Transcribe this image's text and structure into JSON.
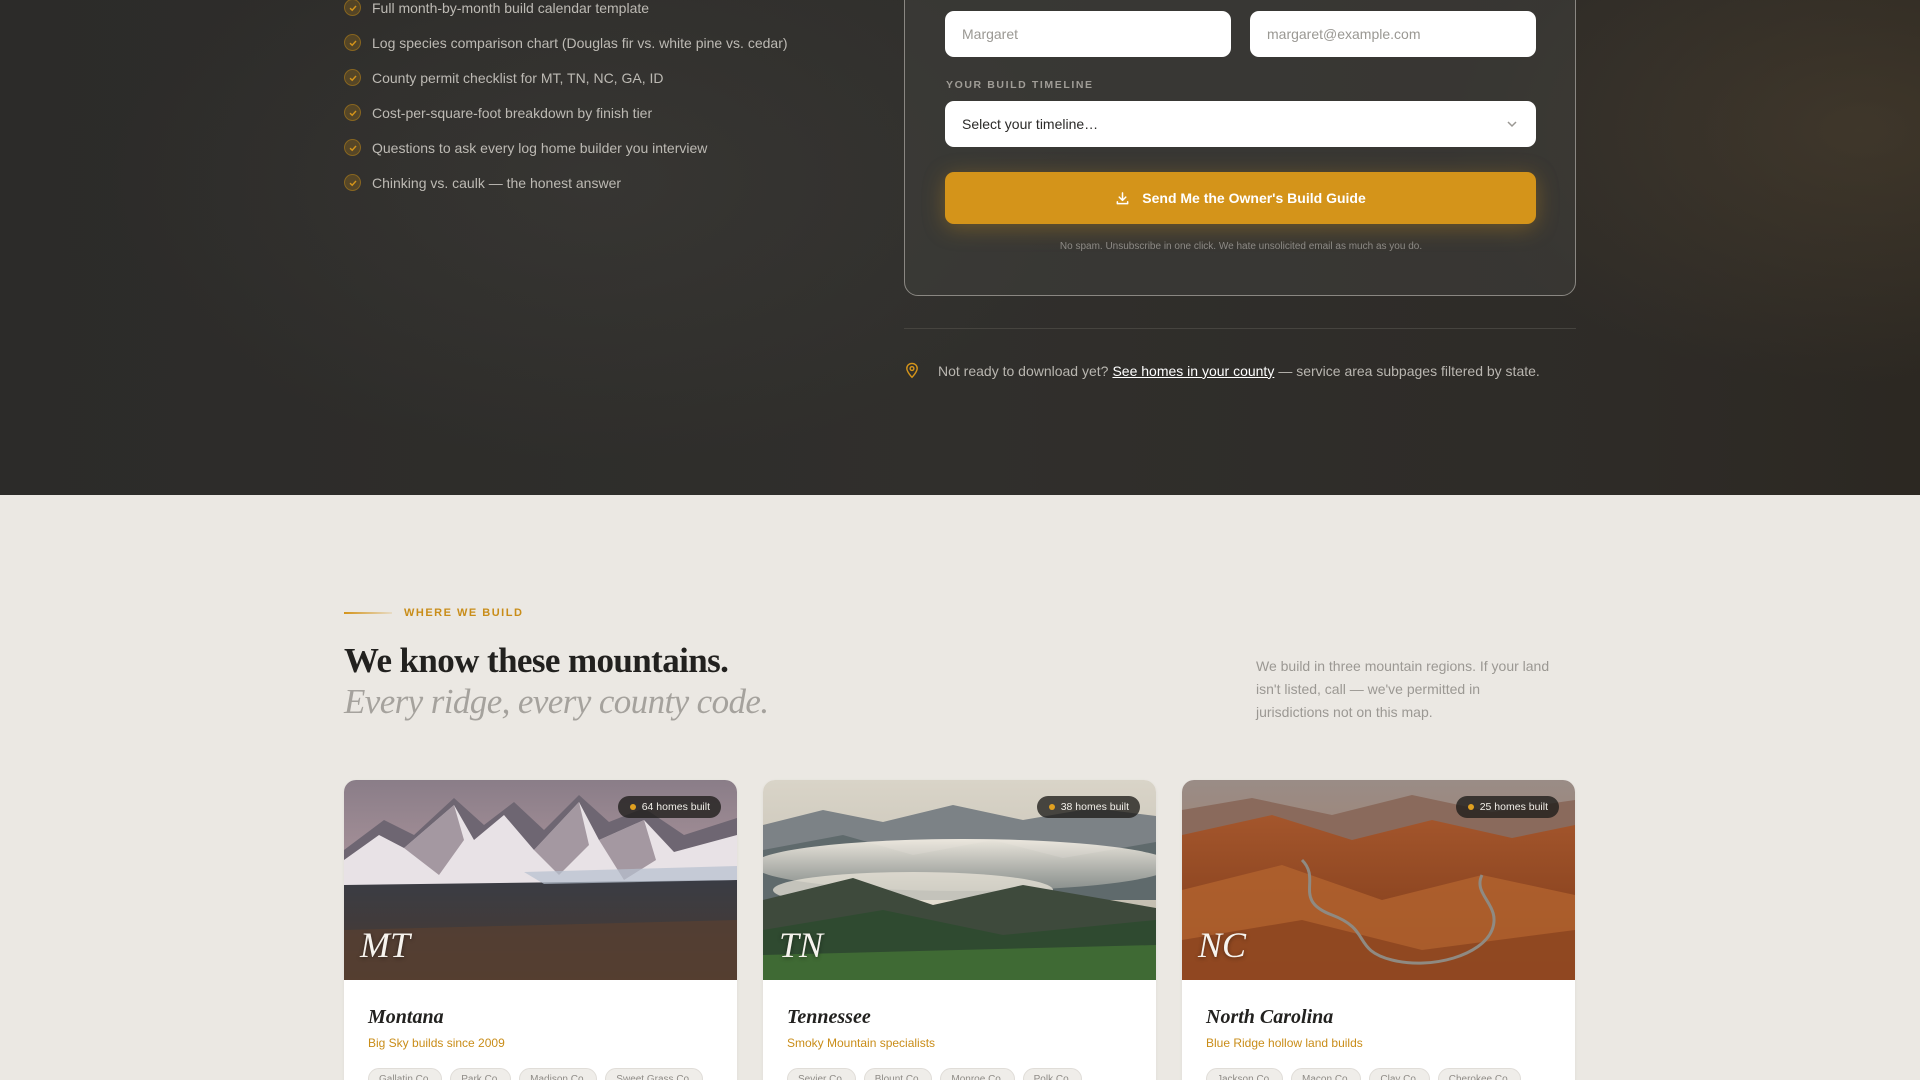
{
  "checklist": {
    "items": [
      "Full month-by-month build calendar template",
      "Log species comparison chart (Douglas fir vs. white pine vs. cedar)",
      "County permit checklist for MT, TN, NC, GA, ID",
      "Cost-per-square-foot breakdown by finish tier",
      "Questions to ask every log home builder you interview",
      "Chinking vs. caulk — the honest answer"
    ]
  },
  "form": {
    "name_placeholder": "Margaret",
    "email_placeholder": "margaret@example.com",
    "timeline_label": "YOUR BUILD TIMELINE",
    "timeline_value": "Select your timeline…",
    "submit_label": "Send Me the Owner's Build Guide",
    "fineprint": "No spam. Unsubscribe in one click. We hate unsolicited email as much as you do."
  },
  "county_note": {
    "before": "Not ready to download yet?",
    "link": "See homes in your county",
    "after": "— service area subpages filtered by state."
  },
  "regions": {
    "eyebrow": "WHERE WE BUILD",
    "headline": "We know these mountains.",
    "subhead": "Every ridge, every county code.",
    "intro": "We build in three mountain regions. If your land isn't listed, call — we've permitted in jurisdictions not on this map.",
    "cards": [
      {
        "abbr": "MT",
        "badge": "64 homes built",
        "title": "Montana",
        "subtitle": "Big Sky builds since 2009",
        "counties": [
          "Gallatin Co.",
          "Park Co.",
          "Madison Co.",
          "Sweet Grass Co."
        ]
      },
      {
        "abbr": "TN",
        "badge": "38 homes built",
        "title": "Tennessee",
        "subtitle": "Smoky Mountain specialists",
        "counties": [
          "Sevier Co.",
          "Blount Co.",
          "Monroe Co.",
          "Polk Co."
        ]
      },
      {
        "abbr": "NC",
        "badge": "25 homes built",
        "title": "North Carolina",
        "subtitle": "Blue Ridge hollow land builds",
        "counties": [
          "Jackson Co.",
          "Macon Co.",
          "Clay Co.",
          "Cherokee Co."
        ]
      }
    ]
  },
  "colors": {
    "accent": "#d4941a",
    "dark_bg": "#2e2d2a",
    "light_bg": "#ebe8e3"
  }
}
